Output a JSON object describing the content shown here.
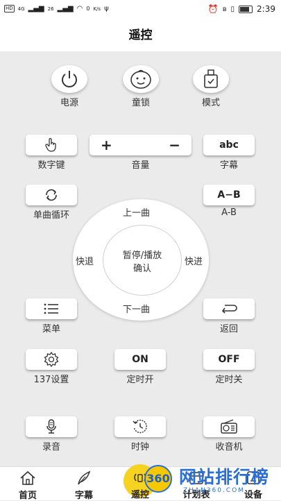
{
  "status_bar": {
    "left": [
      "HD",
      "4G",
      "26",
      "K/s"
    ],
    "speed": "0",
    "time": "2:39"
  },
  "header": {
    "title": "遥控"
  },
  "top_buttons": [
    {
      "label": "电源",
      "icon": "power-icon"
    },
    {
      "label": "童锁",
      "icon": "baby-face-icon"
    },
    {
      "label": "模式",
      "icon": "usb-drive-icon"
    }
  ],
  "row1": {
    "digits_label": "数字键",
    "volume_label": "音量",
    "volume_plus": "+",
    "volume_minus": "−",
    "subtitle_btn": "abc",
    "subtitle_label": "字幕"
  },
  "row2": {
    "repeat_label": "单曲循环",
    "ab_btn": "A−B",
    "ab_label": "A-B"
  },
  "wheel": {
    "up": "上一曲",
    "down": "下一曲",
    "left": "快退",
    "right": "快进",
    "center_line1": "暂停/播放",
    "center_line2": "确认"
  },
  "row3": {
    "menu_label": "菜单",
    "back_label": "返回"
  },
  "row4": {
    "settings_label": "137设置",
    "on_btn": "ON",
    "on_label": "定时开",
    "off_btn": "OFF",
    "off_label": "定时关"
  },
  "row5": {
    "record_label": "录音",
    "clock_label": "时钟",
    "radio_label": "收音机"
  },
  "nav": [
    {
      "label": "首页",
      "icon": "home-icon"
    },
    {
      "label": "字幕",
      "icon": "feather-icon"
    },
    {
      "label": "遥控",
      "icon": "remote-signal-icon"
    },
    {
      "label": "计划表",
      "icon": "calendar-icon"
    },
    {
      "label": "设备",
      "icon": "device-icon"
    }
  ],
  "watermark": {
    "badge": "360",
    "title": "网站排行榜",
    "subtitle": "ZHAN360.COM"
  },
  "colors": {
    "accent": "#f6d321",
    "background": "#ebebeb"
  }
}
